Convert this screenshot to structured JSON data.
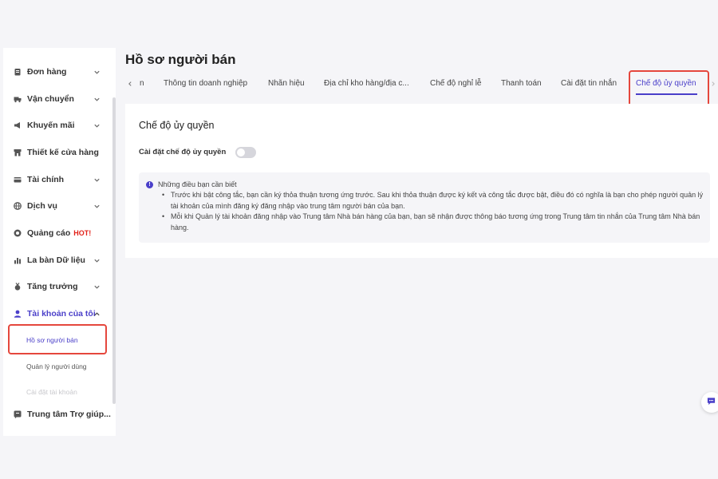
{
  "sidebar": {
    "items": [
      {
        "label": "Đơn hàng",
        "icon": "clipboard-icon",
        "chevron": "down"
      },
      {
        "label": "Vận chuyển",
        "icon": "truck-icon",
        "chevron": "down"
      },
      {
        "label": "Khuyến mãi",
        "icon": "megaphone-icon",
        "chevron": "down"
      },
      {
        "label": "Thiết kế cửa hàng",
        "icon": "store-icon",
        "chevron": ""
      },
      {
        "label": "Tài chính",
        "icon": "card-icon",
        "chevron": "down"
      },
      {
        "label": "Dịch vụ",
        "icon": "globe-icon",
        "chevron": "down"
      },
      {
        "label": "Quảng cáo",
        "icon": "ads-icon",
        "chevron": "",
        "badge": "HOT!"
      },
      {
        "label": "La bàn Dữ liệu",
        "icon": "chart-icon",
        "chevron": "down"
      },
      {
        "label": "Tăng trưởng",
        "icon": "medal-icon",
        "chevron": "down"
      },
      {
        "label": "Tài khoản của tôi",
        "icon": "user-icon",
        "chevron": "up"
      }
    ],
    "sub_items": [
      {
        "label": "Hồ sơ người bán"
      },
      {
        "label": "Quản lý người dùng"
      },
      {
        "label": "Cài đặt tài khoản"
      }
    ],
    "help": {
      "label": "Trung tâm Trợ giúp...",
      "icon": "help-icon"
    }
  },
  "header": {
    "title": "Hồ sơ người bán",
    "tabs": [
      {
        "label": "n"
      },
      {
        "label": "Thông tin doanh nghiệp"
      },
      {
        "label": "Nhãn hiệu"
      },
      {
        "label": "Địa chỉ kho hàng/địa c..."
      },
      {
        "label": "Chế độ nghỉ lễ"
      },
      {
        "label": "Thanh toán"
      },
      {
        "label": "Cài đặt tin nhắn"
      },
      {
        "label": "Chế độ ủy quyền",
        "active": true
      }
    ]
  },
  "card": {
    "title": "Chế độ ủy quyền",
    "setting_label": "Cài đặt chế độ ủy quyền",
    "toggle_on": false,
    "info": {
      "title": "Những điều bạn cần biết",
      "bullets": [
        "Trước khi bật công tắc, bạn cần ký thỏa thuận tương ứng trước. Sau khi thỏa thuận được ký kết và công tắc được bật, điều đó có nghĩa là bạn cho phép người quản lý tài khoản của mình đăng ký đăng nhập vào trung tâm người bán của bạn.",
        "Mỗi khi Quản lý tài khoản đăng nhập vào Trung tâm Nhà bán hàng của bạn, bạn sẽ nhận được thông báo tương ứng trong Trung tâm tin nhắn của Trung tâm Nhà bán hàng."
      ]
    }
  },
  "colors": {
    "accent": "#4a3fc9",
    "highlight_box": "#e5473d",
    "hot": "#e2231a"
  }
}
